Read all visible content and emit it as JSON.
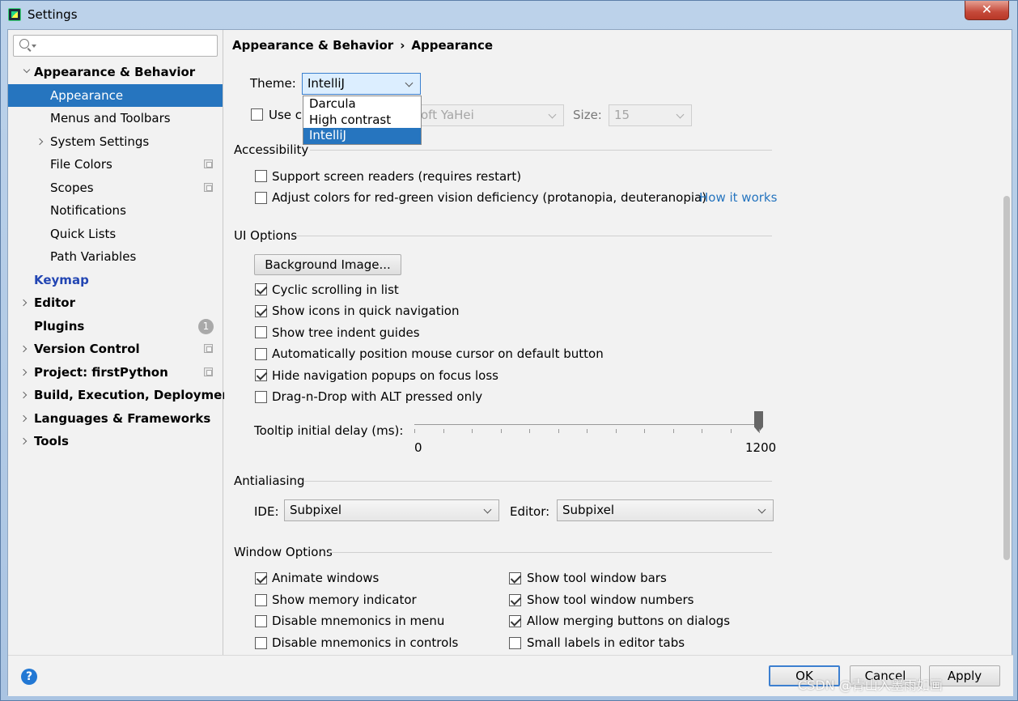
{
  "window": {
    "title": "Settings",
    "close_label": "✕"
  },
  "search": {
    "placeholder": ""
  },
  "sidebar": {
    "items": [
      {
        "label": "Appearance & Behavior"
      },
      {
        "label": "Appearance"
      },
      {
        "label": "Menus and Toolbars"
      },
      {
        "label": "System Settings"
      },
      {
        "label": "File Colors"
      },
      {
        "label": "Scopes"
      },
      {
        "label": "Notifications"
      },
      {
        "label": "Quick Lists"
      },
      {
        "label": "Path Variables"
      },
      {
        "label": "Keymap"
      },
      {
        "label": "Editor"
      },
      {
        "label": "Plugins",
        "badge": "1"
      },
      {
        "label": "Version Control"
      },
      {
        "label": "Project: firstPython"
      },
      {
        "label": "Build, Execution, Deployment"
      },
      {
        "label": "Languages & Frameworks"
      },
      {
        "label": "Tools"
      }
    ],
    "help_label": "?"
  },
  "breadcrumb": {
    "parent": "Appearance & Behavior",
    "separator": "›",
    "current": "Appearance"
  },
  "theme": {
    "label": "Theme:",
    "value": "IntelliJ",
    "options": [
      "Darcula",
      "High contrast",
      "IntelliJ"
    ],
    "selected": "IntelliJ"
  },
  "custom_font": {
    "label_partial": "Use cu",
    "font_value": "oft YaHei",
    "size_label": "Size:",
    "size_value": "15",
    "checked": false
  },
  "accessibility": {
    "title": "Accessibility",
    "screen_readers": "Support screen readers (requires restart)",
    "color_deficiency": "Adjust colors for red-green vision deficiency (protanopia, deuteranopia)",
    "how_it_works": "How it works"
  },
  "ui_options": {
    "title": "UI Options",
    "background_image": "Background Image...",
    "checkboxes": [
      {
        "label": "Cyclic scrolling in list",
        "checked": true
      },
      {
        "label": "Show icons in quick navigation",
        "checked": true
      },
      {
        "label": "Show tree indent guides",
        "checked": false
      },
      {
        "label": "Automatically position mouse cursor on default button",
        "checked": false
      },
      {
        "label": "Hide navigation popups on focus loss",
        "checked": true
      },
      {
        "label": "Drag-n-Drop with ALT pressed only",
        "checked": false
      }
    ],
    "tooltip_label": "Tooltip initial delay (ms):",
    "slider_min": "0",
    "slider_max": "1200",
    "slider_value": 1200
  },
  "antialiasing": {
    "title": "Antialiasing",
    "ide_label": "IDE:",
    "ide_value": "Subpixel",
    "editor_label": "Editor:",
    "editor_value": "Subpixel"
  },
  "window_options": {
    "title": "Window Options",
    "left": [
      {
        "label": "Animate windows",
        "checked": true
      },
      {
        "label": "Show memory indicator",
        "checked": false
      },
      {
        "label": "Disable mnemonics in menu",
        "checked": false
      },
      {
        "label": "Disable mnemonics in controls",
        "checked": false
      }
    ],
    "right": [
      {
        "label": "Show tool window bars",
        "checked": true
      },
      {
        "label": "Show tool window numbers",
        "checked": true
      },
      {
        "label": "Allow merging buttons on dialogs",
        "checked": true
      },
      {
        "label": "Small labels in editor tabs",
        "checked": false
      }
    ]
  },
  "buttons": {
    "ok": "OK",
    "cancel": "Cancel",
    "apply": "Apply"
  },
  "watermark": "CSDN @青山入墨雨如画"
}
